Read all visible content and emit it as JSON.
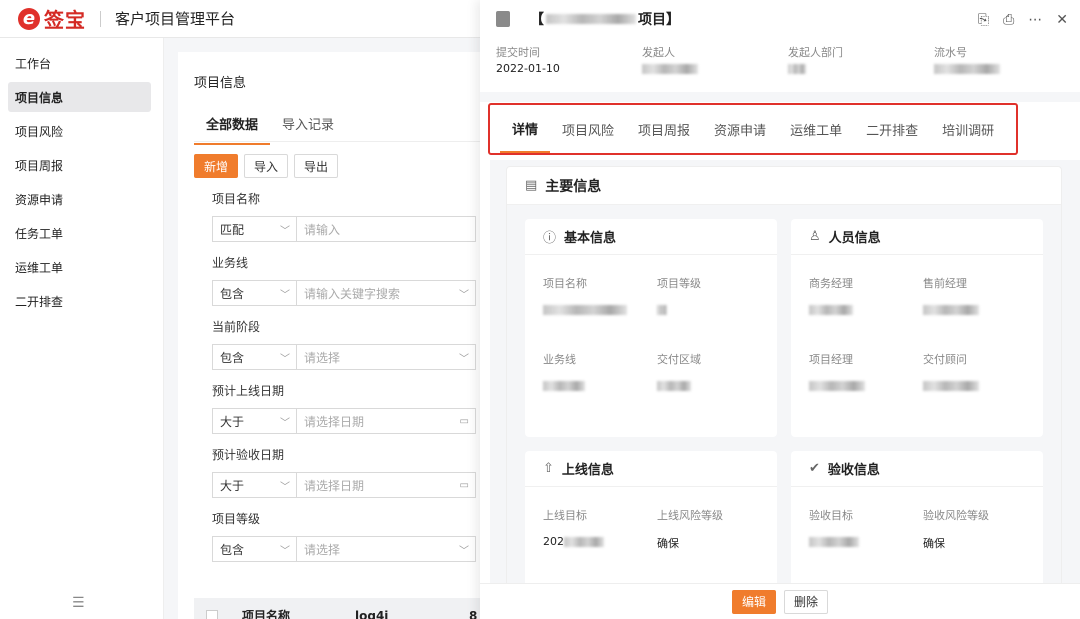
{
  "brand": {
    "logo_text": "签宝",
    "platform": "客户项目管理平台"
  },
  "sidebar": {
    "items": [
      {
        "label": "工作台"
      },
      {
        "label": "项目信息",
        "active": true
      },
      {
        "label": "项目风险"
      },
      {
        "label": "项目周报"
      },
      {
        "label": "资源申请"
      },
      {
        "label": "任务工单"
      },
      {
        "label": "运维工单"
      },
      {
        "label": "二开排查"
      }
    ]
  },
  "main": {
    "title": "项目信息",
    "tabs": [
      "全部数据",
      "导入记录"
    ],
    "buttons": {
      "add": "新增",
      "import": "导入",
      "export": "导出"
    },
    "filters": [
      {
        "label": "项目名称",
        "op": "匹配",
        "placeholder": "请输入",
        "type": "text"
      },
      {
        "label": "业务线",
        "op": "包含",
        "placeholder": "请输入关键字搜索",
        "type": "select"
      },
      {
        "label": "当前阶段",
        "op": "包含",
        "placeholder": "请选择",
        "type": "select"
      },
      {
        "label": "预计上线日期",
        "op": "大于",
        "placeholder": "请选择日期",
        "type": "date"
      },
      {
        "label": "预计验收日期",
        "op": "大于",
        "placeholder": "请选择日期",
        "type": "date"
      },
      {
        "label": "项目等级",
        "op": "包含",
        "placeholder": "请选择",
        "type": "select"
      }
    ],
    "table_headers": [
      "项目名称",
      "log4j",
      "8"
    ]
  },
  "drawer": {
    "title_prefix": "【",
    "title_suffix": "项目】",
    "meta": [
      {
        "key": "提交时间",
        "value": "2022-01-10"
      },
      {
        "key": "发起人",
        "value": ""
      },
      {
        "key": "发起人部门",
        "value": ""
      },
      {
        "key": "流水号",
        "value": ""
      }
    ],
    "tabs": [
      "详情",
      "项目风险",
      "项目周报",
      "资源申请",
      "运维工单",
      "二开排查",
      "培训调研"
    ],
    "main_title": "主要信息",
    "panels": {
      "basic": {
        "title": "基本信息",
        "fields": [
          {
            "k": "项目名称"
          },
          {
            "k": "项目等级"
          },
          {
            "k": "业务线"
          },
          {
            "k": "交付区域"
          }
        ]
      },
      "people": {
        "title": "人员信息",
        "fields": [
          {
            "k": "商务经理"
          },
          {
            "k": "售前经理"
          },
          {
            "k": "项目经理"
          },
          {
            "k": "交付顾问"
          }
        ]
      },
      "launch": {
        "title": "上线信息",
        "fields": [
          {
            "k": "上线目标",
            "v": "202"
          },
          {
            "k": "上线风险等级",
            "v": "确保"
          }
        ]
      },
      "accept": {
        "title": "验收信息",
        "fields": [
          {
            "k": "验收目标"
          },
          {
            "k": "验收风险等级",
            "v": "确保"
          }
        ]
      }
    },
    "footer": {
      "edit": "编辑",
      "delete": "删除"
    }
  },
  "colors": {
    "accent": "#f07c2c",
    "brand_red": "#e0312b"
  }
}
